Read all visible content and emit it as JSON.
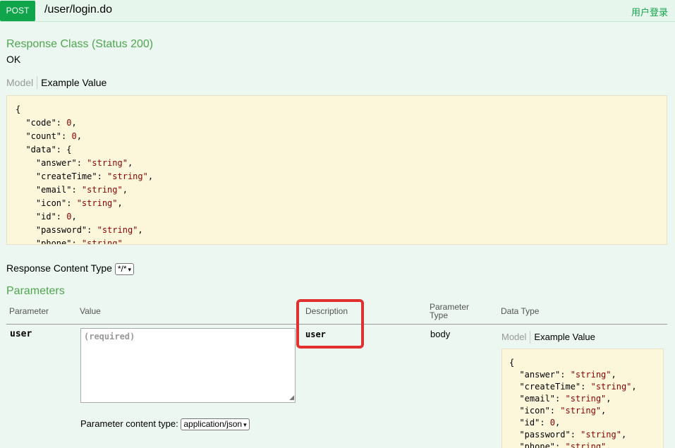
{
  "operation": {
    "method": "POST",
    "path": "/user/login.do",
    "summary": "用户登录"
  },
  "response_class": {
    "heading": "Response Class (Status 200)",
    "message": "OK",
    "tab_model": "Model",
    "tab_example": "Example Value",
    "example_lines": [
      {
        "text": "{"
      },
      {
        "text": "  \"code\": ",
        "val": "0",
        "tail": ","
      },
      {
        "text": "  \"count\": ",
        "val": "0",
        "tail": ","
      },
      {
        "text": "  \"data\": {"
      },
      {
        "text": "    \"answer\": ",
        "val": "\"string\"",
        "tail": ","
      },
      {
        "text": "    \"createTime\": ",
        "val": "\"string\"",
        "tail": ","
      },
      {
        "text": "    \"email\": ",
        "val": "\"string\"",
        "tail": ","
      },
      {
        "text": "    \"icon\": ",
        "val": "\"string\"",
        "tail": ","
      },
      {
        "text": "    \"id\": ",
        "val": "0",
        "tail": ","
      },
      {
        "text": "    \"password\": ",
        "val": "\"string\"",
        "tail": ","
      },
      {
        "text": "    \"phone\": ",
        "val": "\"string\"",
        "tail": ","
      }
    ]
  },
  "response_content_type": {
    "label": "Response Content Type",
    "selected": "*/*"
  },
  "parameters": {
    "heading": "Parameters",
    "columns": {
      "parameter": "Parameter",
      "value": "Value",
      "description": "Description",
      "parameter_type": "Parameter Type",
      "data_type": "Data Type"
    },
    "row": {
      "name": "user",
      "placeholder": "(required)",
      "description": "user",
      "parameter_type": "body",
      "content_type_label": "Parameter content type:",
      "content_type_selected": "application/json",
      "tab_model": "Model",
      "tab_example": "Example Value",
      "example_lines": [
        {
          "text": "{"
        },
        {
          "text": "  \"answer\": ",
          "val": "\"string\"",
          "tail": ","
        },
        {
          "text": "  \"createTime\": ",
          "val": "\"string\"",
          "tail": ","
        },
        {
          "text": "  \"email\": ",
          "val": "\"string\"",
          "tail": ","
        },
        {
          "text": "  \"icon\": ",
          "val": "\"string\"",
          "tail": ","
        },
        {
          "text": "  \"id\": ",
          "val": "0",
          "tail": ","
        },
        {
          "text": "  \"password\": ",
          "val": "\"string\"",
          "tail": ","
        },
        {
          "text": "  \"phone\": ",
          "val": "\"string\"",
          "tail": ","
        }
      ]
    }
  },
  "colors": {
    "method_green": "#10a54a",
    "heading_green": "#4fa64f",
    "highlight_red": "#e03030",
    "json_bg": "#fcf6db"
  }
}
